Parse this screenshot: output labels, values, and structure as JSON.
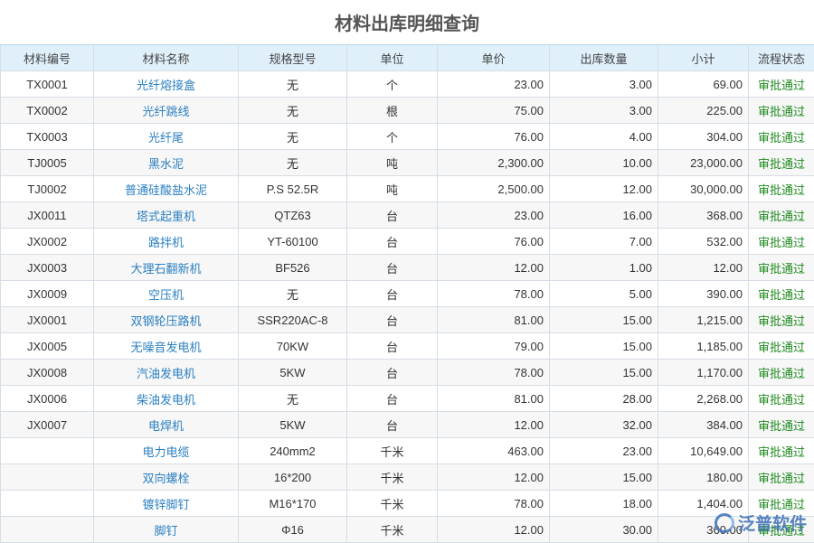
{
  "page": {
    "title": "材料出库明细查询"
  },
  "columns": [
    "材料编号",
    "材料名称",
    "规格型号",
    "单位",
    "单价",
    "出库数量",
    "小计",
    "流程状态"
  ],
  "rows": [
    [
      "TX0001",
      "光纤熔接盒",
      "无",
      "个",
      "23.00",
      "3.00",
      "69.00",
      "审批通过"
    ],
    [
      "TX0002",
      "光纤跳线",
      "无",
      "根",
      "75.00",
      "3.00",
      "225.00",
      "审批通过"
    ],
    [
      "TX0003",
      "光纤尾",
      "无",
      "个",
      "76.00",
      "4.00",
      "304.00",
      "审批通过"
    ],
    [
      "TJ0005",
      "黑水泥",
      "无",
      "吨",
      "2,300.00",
      "10.00",
      "23,000.00",
      "审批通过"
    ],
    [
      "TJ0002",
      "普通硅酸盐水泥",
      "P.S 52.5R",
      "吨",
      "2,500.00",
      "12.00",
      "30,000.00",
      "审批通过"
    ],
    [
      "JX0011",
      "塔式起重机",
      "QTZ63",
      "台",
      "23.00",
      "16.00",
      "368.00",
      "审批通过"
    ],
    [
      "JX0002",
      "路拌机",
      "YT-60100",
      "台",
      "76.00",
      "7.00",
      "532.00",
      "审批通过"
    ],
    [
      "JX0003",
      "大理石翻新机",
      "BF526",
      "台",
      "12.00",
      "1.00",
      "12.00",
      "审批通过"
    ],
    [
      "JX0009",
      "空压机",
      "无",
      "台",
      "78.00",
      "5.00",
      "390.00",
      "审批通过"
    ],
    [
      "JX0001",
      "双钢轮压路机",
      "SSR220AC-8",
      "台",
      "81.00",
      "15.00",
      "1,215.00",
      "审批通过"
    ],
    [
      "JX0005",
      "无噪音发电机",
      "70KW",
      "台",
      "79.00",
      "15.00",
      "1,185.00",
      "审批通过"
    ],
    [
      "JX0008",
      "汽油发电机",
      "5KW",
      "台",
      "78.00",
      "15.00",
      "1,170.00",
      "审批通过"
    ],
    [
      "JX0006",
      "柴油发电机",
      "无",
      "台",
      "81.00",
      "28.00",
      "2,268.00",
      "审批通过"
    ],
    [
      "JX0007",
      "电焊机",
      "5KW",
      "台",
      "12.00",
      "32.00",
      "384.00",
      "审批通过"
    ],
    [
      "",
      "电力电缆",
      "240mm2",
      "千米",
      "463.00",
      "23.00",
      "10,649.00",
      "审批通过"
    ],
    [
      "",
      "双向螺栓",
      "16*200",
      "千米",
      "12.00",
      "15.00",
      "180.00",
      "审批通过"
    ],
    [
      "",
      "镀锌脚钉",
      "M16*170",
      "千米",
      "78.00",
      "18.00",
      "1,404.00",
      "审批通过"
    ],
    [
      "",
      "脚钉",
      "Φ16",
      "千米",
      "12.00",
      "30.00",
      "360.00",
      "审批通过"
    ]
  ],
  "logo": {
    "text": "泛普软件",
    "icon": "fanpu-logo-icon"
  },
  "colors": {
    "header_bg": "#dff0fb",
    "link": "#2a7fc1",
    "status": "#1f8a1f",
    "title": "#555555"
  }
}
